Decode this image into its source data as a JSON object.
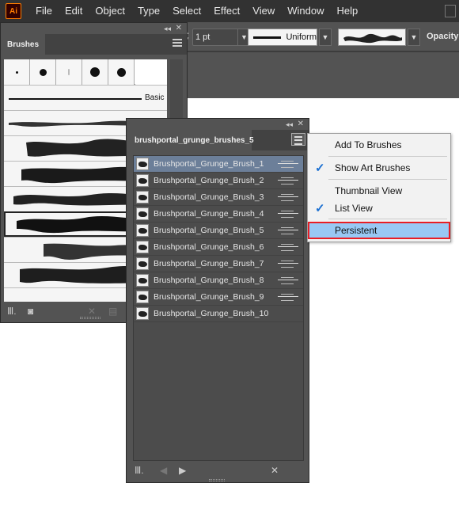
{
  "app": {
    "logo": "Ai",
    "accent_color": "#ff7c00",
    "menus": [
      "File",
      "Edit",
      "Object",
      "Type",
      "Select",
      "Effect",
      "View",
      "Window",
      "Help"
    ]
  },
  "control_bar": {
    "stroke_weight": "1 pt",
    "profile_label": "Uniform",
    "opacity_label": "Opacity:"
  },
  "brushes_panel": {
    "tab_label": "Brushes",
    "collapse_glyph": "◂◂",
    "basic_label": "Basic",
    "selected_row_index": 5,
    "footer_icons": [
      "brush-libraries-icon",
      "library-panel-icon",
      "remove-stroke-icon",
      "delete-icon"
    ]
  },
  "library_panel": {
    "tab_label": "brushportal_grunge_brushes_5",
    "collapse_glyph": "◂◂",
    "selected_index": 0,
    "brushes": [
      "Brushportal_Grunge_Brush_1",
      "Brushportal_Grunge_Brush_2",
      "Brushportal_Grunge_Brush_3",
      "Brushportal_Grunge_Brush_4",
      "Brushportal_Grunge_Brush_5",
      "Brushportal_Grunge_Brush_6",
      "Brushportal_Grunge_Brush_7",
      "Brushportal_Grunge_Brush_8",
      "Brushportal_Grunge_Brush_9",
      "Brushportal_Grunge_Brush_10"
    ],
    "footer_icons": [
      "brush-libraries-icon",
      "previous-library-icon",
      "next-library-icon",
      "remove-stroke-icon"
    ]
  },
  "context_menu": {
    "items": [
      {
        "label": "Add To Brushes",
        "checked": false
      },
      {
        "label": "Show Art Brushes",
        "checked": true
      },
      {
        "label": "Thumbnail View",
        "checked": false
      },
      {
        "label": "List View",
        "checked": true
      },
      {
        "label": "Persistent",
        "checked": false,
        "highlighted": true
      }
    ],
    "highlight_color": "#99c9f4",
    "highlight_border_color": "#e81e25",
    "check_color": "#1a6fd1"
  }
}
